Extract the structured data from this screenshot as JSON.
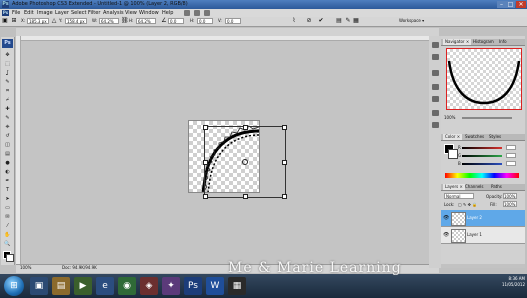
{
  "window": {
    "title": "Adobe Photoshop CS3 Extended - Untitled-1 @ 100% (Layer 2, RGB/8)",
    "controls": [
      "–",
      "□",
      "✕"
    ]
  },
  "menubar": {
    "logo": "Ps",
    "items": [
      "File",
      "Edit",
      "Image",
      "Layer",
      "Select",
      "Filter",
      "Analysis",
      "View",
      "Window",
      "Help"
    ]
  },
  "options": {
    "x_label": "X:",
    "x_value": "185.3 px",
    "y_label": "Y:",
    "y_value": "158.4 px",
    "w_label": "W:",
    "w_value": "64.2%",
    "h_label": "H:",
    "h_value": "64.2%",
    "angle_value": "0.0",
    "h_skew_label": "H:",
    "h_skew_value": "0.0",
    "v_skew_label": "V:",
    "v_skew_value": "0.0",
    "workspace": "Workspace ▾"
  },
  "tools": {
    "badge": "Ps",
    "icons": [
      "move-tool-icon",
      "marquee-tool-icon",
      "lasso-tool-icon",
      "quick-select-tool-icon",
      "crop-tool-icon",
      "slice-tool-icon",
      "healing-brush-icon",
      "brush-tool-icon",
      "clone-stamp-icon",
      "history-brush-icon",
      "eraser-tool-icon",
      "gradient-tool-icon",
      "blur-tool-icon",
      "dodge-tool-icon",
      "pen-tool-icon",
      "type-tool-icon",
      "path-select-icon",
      "shape-tool-icon",
      "notes-tool-icon",
      "eyedropper-icon",
      "hand-tool-icon",
      "zoom-tool-icon"
    ],
    "glyphs": [
      "✥",
      "⬚",
      "ʆ",
      "✎",
      "⌗",
      "⌿",
      "✚",
      "✎",
      "⎈",
      "↺",
      "◫",
      "▤",
      "●",
      "◐",
      "✒",
      "T",
      "➤",
      "▭",
      "✉",
      "⁄",
      "✋",
      "🔍"
    ]
  },
  "status": {
    "zoom": "100%",
    "doc": "Doc: 94.9K/94.9K"
  },
  "navigator": {
    "tabs": [
      "Navigator ×",
      "Histogram",
      "Info"
    ],
    "zoom": "100%"
  },
  "color": {
    "tabs": [
      "Color ×",
      "Swatches",
      "Styles"
    ],
    "channels": [
      {
        "label": "R",
        "value": "",
        "color": "#d8322e"
      },
      {
        "label": "G",
        "value": "",
        "color": "#2fa64a"
      },
      {
        "label": "B",
        "value": "",
        "color": "#2c4fbf"
      }
    ]
  },
  "layers": {
    "tabs": [
      "Layers ×",
      "Channels",
      "Paths"
    ],
    "blend_mode": "Normal",
    "opacity_label": "Opacity:",
    "opacity_value": "100%",
    "lock_label": "Lock:",
    "fill_label": "Fill:",
    "fill_value": "100%",
    "items": [
      {
        "name": "Layer 2",
        "selected": true
      },
      {
        "name": "Layer 1",
        "selected": false
      }
    ]
  },
  "taskbar": {
    "watermark": "Me & Marie Learning",
    "time": "8:36 AM",
    "date": "11/05/2012"
  },
  "colors": {
    "accent_selected_layer": "#5fa8e8",
    "titlebar": "#3a6aab"
  }
}
